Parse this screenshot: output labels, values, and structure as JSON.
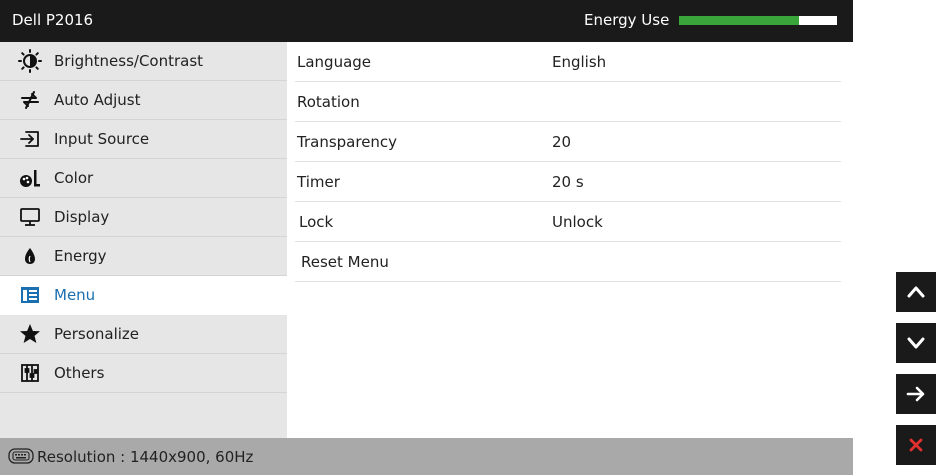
{
  "header": {
    "title": "Dell P2016",
    "energy_label": "Energy Use",
    "energy_level": 0.76,
    "energy_color": "#3aa53a"
  },
  "sidebar": {
    "items": [
      {
        "label": "Brightness/Contrast",
        "icon": "brightness-icon"
      },
      {
        "label": "Auto Adjust",
        "icon": "auto-adjust-icon"
      },
      {
        "label": "Input Source",
        "icon": "input-source-icon"
      },
      {
        "label": "Color",
        "icon": "color-icon"
      },
      {
        "label": "Display",
        "icon": "display-icon"
      },
      {
        "label": "Energy",
        "icon": "energy-icon"
      },
      {
        "label": "Menu",
        "icon": "menu-icon",
        "active": true
      },
      {
        "label": "Personalize",
        "icon": "star-icon"
      },
      {
        "label": "Others",
        "icon": "others-icon"
      }
    ],
    "active_color": "#1a6fb0"
  },
  "settings": {
    "rows": [
      {
        "key": "Language",
        "value": "English"
      },
      {
        "key": "Rotation",
        "value": ""
      },
      {
        "key": "Transparency",
        "value": "20"
      },
      {
        "key": "Timer",
        "value": "20 s"
      },
      {
        "key": "Lock",
        "value": "Unlock"
      },
      {
        "key": "Reset Menu",
        "value": ""
      }
    ]
  },
  "footer": {
    "text": "Resolution : 1440x900, 60Hz",
    "icon": "keyboard-icon"
  },
  "nav_buttons": {
    "up": "chevron-up-icon",
    "down": "chevron-down-icon",
    "enter": "arrow-right-icon",
    "exit": "close-icon",
    "exit_color": "#e03030"
  }
}
